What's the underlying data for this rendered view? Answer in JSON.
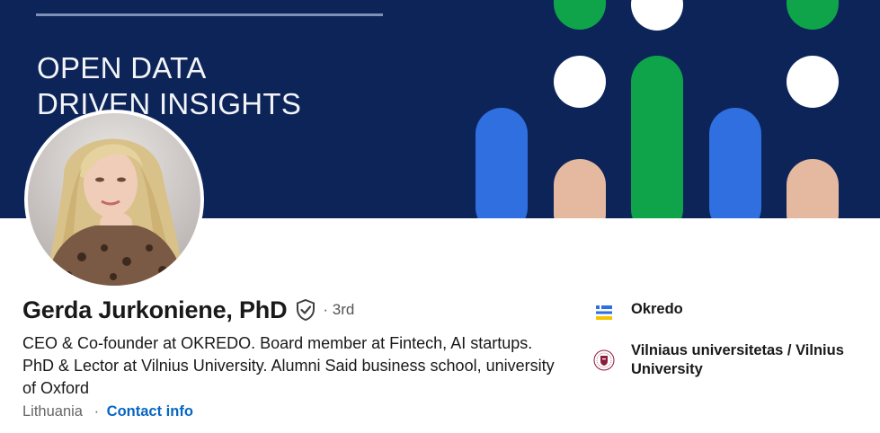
{
  "banner": {
    "title_line1": "OPEN DATA",
    "title_line2": "DRIVEN INSIGHTS",
    "colors": {
      "background": "#0d2459",
      "green": "#0fa34a",
      "blue": "#2f6fe0",
      "peach": "#e4b9a0",
      "white": "#ffffff"
    }
  },
  "profile": {
    "name": "Gerda Jurkoniene, PhD",
    "verified_icon": "shield-check-icon",
    "degree": "· 3rd",
    "headline": "CEO & Co-founder at OKREDO. Board member at Fintech, AI startups. PhD & Lector at Vilnius University. Alumni Said business school, university of Oxford",
    "location": "Lithuania",
    "separator": "·",
    "contact_label": "Contact info"
  },
  "experience": [
    {
      "name": "Okredo",
      "logo": "okredo-logo"
    },
    {
      "name": "Vilniaus universitetas / Vilnius University",
      "logo": "vilnius-university-seal"
    }
  ],
  "colors": {
    "link": "#0a66c2",
    "text": "#191919",
    "muted": "#666666"
  }
}
